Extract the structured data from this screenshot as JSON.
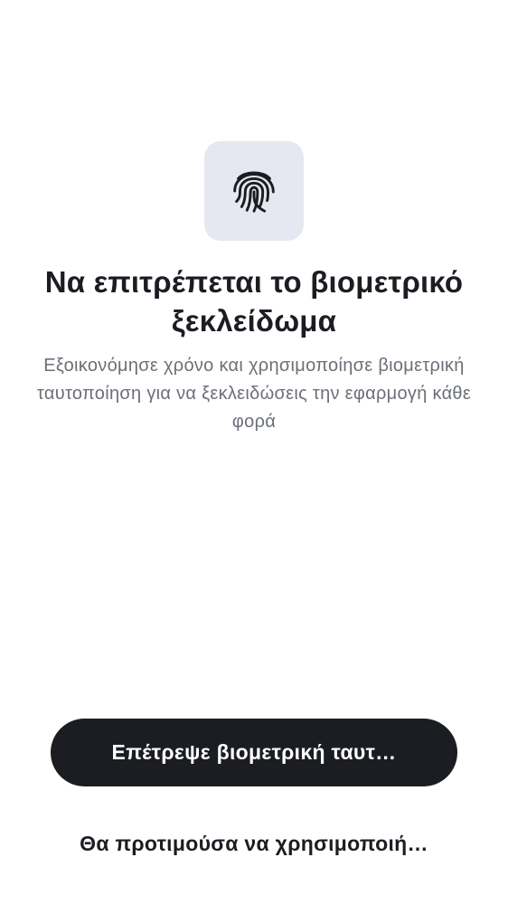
{
  "icon": {
    "name": "fingerprint-icon",
    "tile_color": "#e5e8f0",
    "stroke_color": "#1b1d22"
  },
  "title": "Να επιτρέπεται το βιομετρικό ξεκλείδωμα",
  "subtitle": "Εξοικονόμησε χρόνο και χρησιμοποίησε βιομετρική ταυτοποίηση για να ξεκλειδώσεις την εφαρμογή κάθε φορά",
  "actions": {
    "primary_label": "Επέτρεψε βιομετρική ταυτ…",
    "secondary_label": "Θα προτιμούσα να χρησιμοποιή…"
  },
  "colors": {
    "primary": "#1b1d22",
    "text_secondary": "#6b6f77",
    "background": "#ffffff"
  }
}
